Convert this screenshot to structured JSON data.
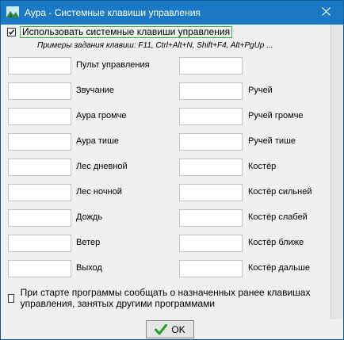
{
  "window": {
    "title": "Аура - Системные клавиши управления",
    "close_icon": "close-icon",
    "app_icon": "landscape-app-icon"
  },
  "main_option": {
    "checked": true,
    "label": "Использовать системные клавиши управления"
  },
  "examples_text": "Примеры задания клавиш: F11, Ctrl+Alt+N, Shift+F4, Alt+PgUp ...",
  "left_column": [
    {
      "label": "Пульт управления",
      "value": ""
    },
    {
      "label": "Звучание",
      "value": ""
    },
    {
      "label": "Аура громче",
      "value": ""
    },
    {
      "label": "Аура тише",
      "value": ""
    },
    {
      "label": "Лес дневной",
      "value": ""
    },
    {
      "label": "Лес ночной",
      "value": ""
    },
    {
      "label": "Дождь",
      "value": ""
    },
    {
      "label": "Ветер",
      "value": ""
    },
    {
      "label": "Выход",
      "value": ""
    }
  ],
  "right_column": [
    {
      "label": "",
      "value": ""
    },
    {
      "label": "Ручей",
      "value": ""
    },
    {
      "label": "Ручей громче",
      "value": ""
    },
    {
      "label": "Ручей тише",
      "value": ""
    },
    {
      "label": "Костёр",
      "value": ""
    },
    {
      "label": "Костёр сильней",
      "value": ""
    },
    {
      "label": "Костёр слабей",
      "value": ""
    },
    {
      "label": "Костёр ближе",
      "value": ""
    },
    {
      "label": "Костёр дальше",
      "value": ""
    }
  ],
  "startup_option": {
    "checked": false,
    "label": "При старте программы сообщать о назначенных ранее клавишах управления, занятых другими программами"
  },
  "ok_button": {
    "label": "OK",
    "icon": "checkmark-icon",
    "icon_color": "#2a9d2a"
  }
}
